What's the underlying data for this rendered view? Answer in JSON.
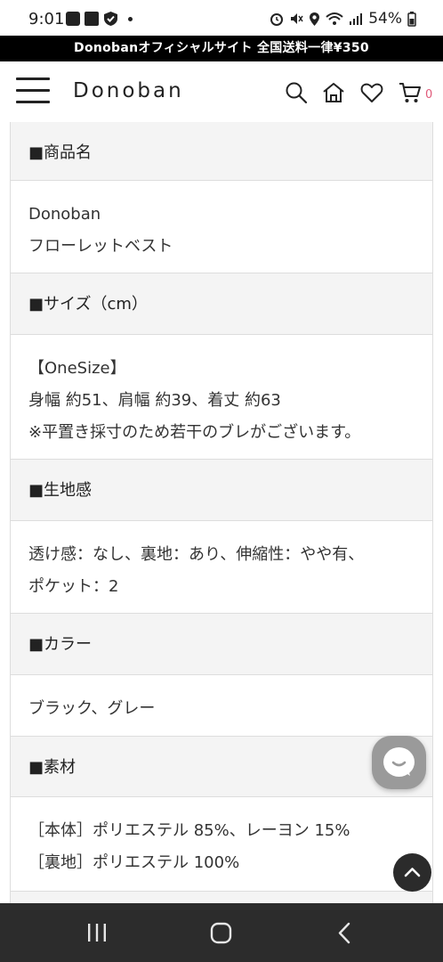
{
  "status_bar": {
    "time": "9:01",
    "battery": "54%",
    "icons": [
      "gallery-icon",
      "mail-icon",
      "shield-icon",
      "alarm-icon",
      "mute-icon",
      "location-icon",
      "wifi-icon",
      "signal-icon",
      "battery-icon"
    ]
  },
  "banner": {
    "text": "Donobanオフィシャルサイト 全国送料一律¥350"
  },
  "header": {
    "logo": "Donoban",
    "cart_count": "0",
    "cart_count_color": "#e05a7a"
  },
  "spec_table": [
    {
      "heading": "■商品名",
      "lines": [
        "Donoban",
        "フローレットベスト"
      ]
    },
    {
      "heading": "■サイズ（cm）",
      "lines": [
        "【OneSize】",
        "身幅 約51、肩幅 約39、着丈 約63",
        "※平置き採寸のため若干のブレがございます。"
      ]
    },
    {
      "heading": "■生地感",
      "lines": [
        "透け感：なし、裏地：あり、伸縮性：やや有、",
        "ポケット：2"
      ]
    },
    {
      "heading": "■カラー",
      "lines": [
        "ブラック、グレー"
      ]
    },
    {
      "heading": "■素材",
      "lines": [
        "［本体］ポリエステル 85%、レーヨン 15%",
        "［裏地］ポリエステル 100%"
      ]
    }
  ],
  "colors": {
    "banner_bg": "#000000",
    "heading_bg": "#f4f4f4",
    "nav_bar_bg": "#2c2c2c",
    "chat_button_bg": "#9a9a9a"
  }
}
